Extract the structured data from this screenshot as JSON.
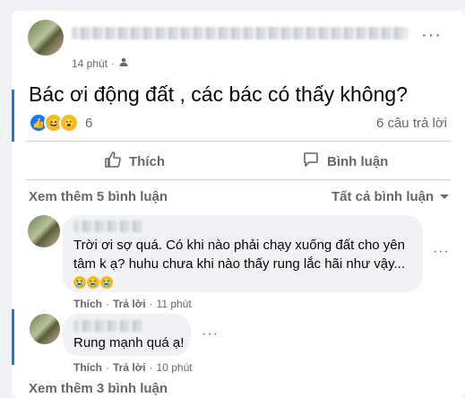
{
  "post": {
    "time": "14 phút",
    "privacy_icon": "friends-icon",
    "text": "Bác ơi động đất , các bác có thấy không?",
    "reaction_count": "6",
    "reply_count": "6 câu trả lời"
  },
  "actions": {
    "like": "Thích",
    "comment": "Bình luận"
  },
  "comments_header": {
    "see_more_top": "Xem thêm 5 bình luận",
    "filter": "Tất cả bình luận"
  },
  "comments": [
    {
      "line1": "Trời ơi sợ quá. Có khi nào phải chạy xuống đất cho yên",
      "line2": "tâm k ạ? huhu chưa khi nào thấy rung lắc hãi như vậy...",
      "like": "Thích",
      "reply": "Trả lời",
      "time": "11 phút",
      "sep": "·"
    },
    {
      "line1": "Rung mạnh quá ạ!",
      "like": "Thích",
      "reply": "Trả lời",
      "time": "10 phút",
      "sep": "·"
    }
  ],
  "see_more_bottom": "Xem thêm 3 bình luận",
  "colors": {
    "accent": "#1877f2",
    "muted": "#65676b",
    "bubble": "#f0f2f5"
  }
}
